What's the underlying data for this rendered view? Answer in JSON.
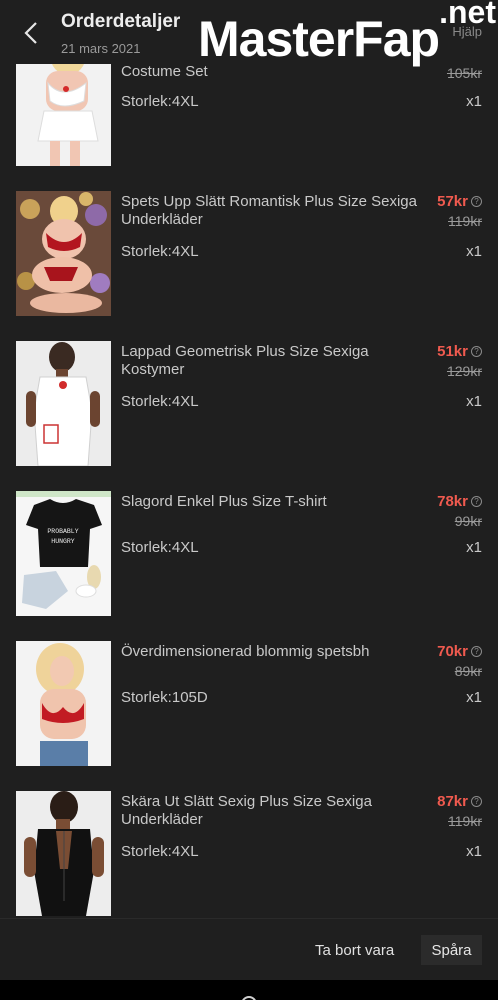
{
  "header": {
    "title": "Orderdetaljer",
    "date": "21 mars 2021",
    "action": "Hjälp"
  },
  "watermark": {
    "main": "MasterFap",
    "tld": ".net"
  },
  "items": [
    {
      "name": "Costume Set",
      "size": "Storlek:4XL",
      "price": "",
      "original_price": "105kr",
      "qty": "x1"
    },
    {
      "name": "Spets Upp Slätt Romantisk Plus Size Sexiga Underkläder",
      "size": "Storlek:4XL",
      "price": "57kr",
      "original_price": "119kr",
      "qty": "x1"
    },
    {
      "name": "Lappad Geometrisk Plus Size Sexiga Kostymer",
      "size": "Storlek:4XL",
      "price": "51kr",
      "original_price": "129kr",
      "qty": "x1"
    },
    {
      "name": "Slagord Enkel Plus Size T-shirt",
      "size": "Storlek:4XL",
      "price": "78kr",
      "original_price": "99kr",
      "qty": "x1"
    },
    {
      "name": "Överdimensionerad blommig spetsbh",
      "size": "Storlek:105D",
      "price": "70kr",
      "original_price": "89kr",
      "qty": "x1"
    },
    {
      "name": "Skära Ut Slätt Sexig Plus Size Sexiga Underkläder",
      "size": "Storlek:4XL",
      "price": "87kr",
      "original_price": "119kr",
      "qty": "x1"
    }
  ],
  "tshirt_print": "PROBABLY HUNGRY",
  "footer": {
    "remove_label": "Ta bort vara",
    "track_label": "Spåra"
  },
  "colors": {
    "background": "#1f1f1f",
    "price": "#f05a4f",
    "text": "#c9c9c9"
  }
}
